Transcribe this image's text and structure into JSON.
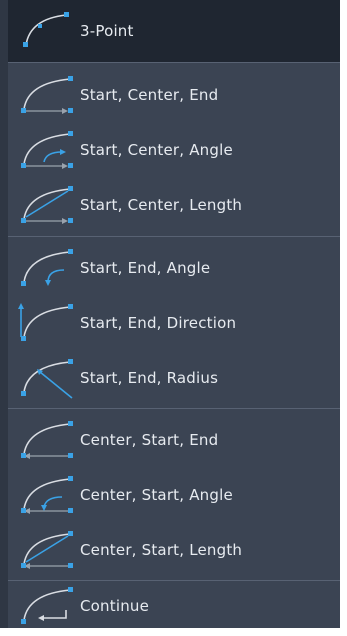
{
  "menu": {
    "items": [
      {
        "label": "3-Point",
        "icon": "arc-3point-icon"
      },
      {
        "label": "Start, Center, End",
        "icon": "arc-start-center-end-icon"
      },
      {
        "label": "Start, Center, Angle",
        "icon": "arc-start-center-angle-icon"
      },
      {
        "label": "Start, Center, Length",
        "icon": "arc-start-center-length-icon"
      },
      {
        "label": "Start, End, Angle",
        "icon": "arc-start-end-angle-icon"
      },
      {
        "label": "Start, End, Direction",
        "icon": "arc-start-end-direction-icon"
      },
      {
        "label": "Start, End, Radius",
        "icon": "arc-start-end-radius-icon"
      },
      {
        "label": "Center, Start, End",
        "icon": "arc-center-start-end-icon"
      },
      {
        "label": "Center, Start, Angle",
        "icon": "arc-center-start-angle-icon"
      },
      {
        "label": "Center, Start, Length",
        "icon": "arc-center-start-length-icon"
      },
      {
        "label": "Continue",
        "icon": "arc-continue-icon"
      }
    ]
  },
  "colors": {
    "background": "#3b4453",
    "selected": "#1f2631",
    "text": "#e7ebf0",
    "accent": "#3aa2e6"
  }
}
